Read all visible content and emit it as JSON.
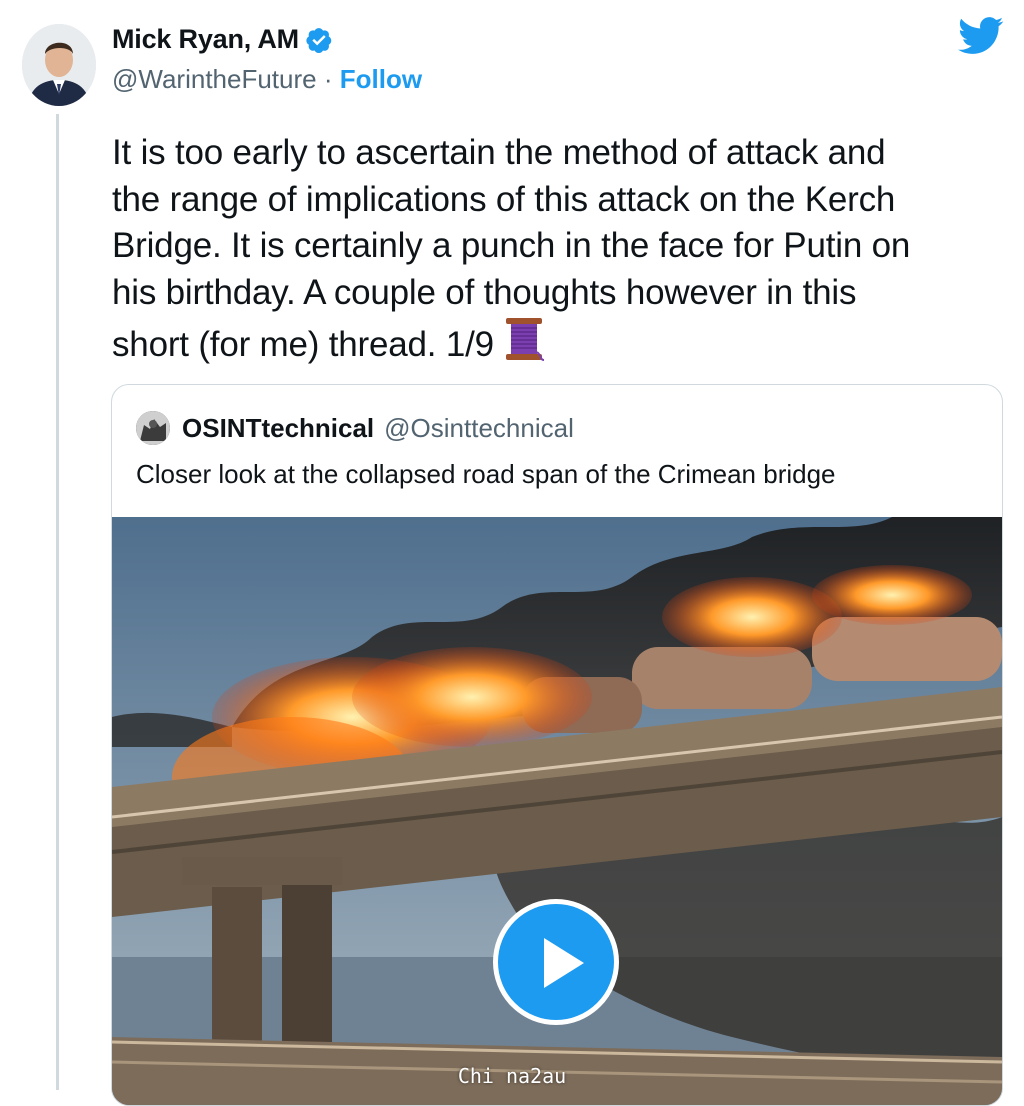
{
  "author": {
    "name": "Mick Ryan, AM",
    "handle": "@WarintheFuture",
    "separator": "·",
    "follow_label": "Follow",
    "avatar_icon": "user-avatar",
    "verified_icon": "verified-badge-icon"
  },
  "brand": {
    "icon": "twitter-bird-icon",
    "color": "#1d9bf0"
  },
  "tweet": {
    "text_lines": [
      "It is too early to ascertain the method of attack and",
      "the range of implications of this attack on the Kerch",
      "Bridge. It is certainly a punch in the face for Putin on",
      "his birthday. A couple of thoughts however in this",
      "short (for me) thread. 1/9"
    ],
    "emoji_icon": "thread-spool-icon"
  },
  "quoted": {
    "name": "OSINTtechnical",
    "handle": "@Osinttechnical",
    "text": "Closer look at the collapsed road span of the Crimean bridge",
    "media_icon": "video-thumbnail",
    "play_icon": "play-icon"
  },
  "watermark": "Chi na2au",
  "colors": {
    "text": "#0f1419",
    "muted": "#536471",
    "accent": "#1d9bf0",
    "border": "#cfd9de"
  }
}
